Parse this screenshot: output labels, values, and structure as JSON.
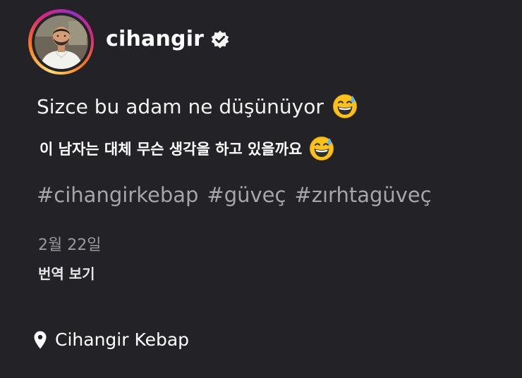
{
  "post": {
    "username": "cihangir",
    "caption": "Sizce bu adam ne düşünüyor",
    "translation": "이 남자는 대체 무슨 생각을 하고 있을까요",
    "hashtags": [
      "#cihangirkebap",
      "#güveç",
      "#zırhtagüveç"
    ],
    "date": "2월 22일",
    "translate_label": "번역 보기",
    "location": "Cihangir Kebap"
  },
  "icons": {
    "verified": "verified-badge-icon",
    "emoji": "grinning-face-with-sweat-emoji",
    "location": "location-pin-icon"
  },
  "colors": {
    "background": "#232227",
    "text": "#ffffff",
    "muted": "#a6a6a8",
    "ring_start": "#feda75",
    "ring_mid": "#d62976",
    "ring_end": "#962fbf"
  }
}
